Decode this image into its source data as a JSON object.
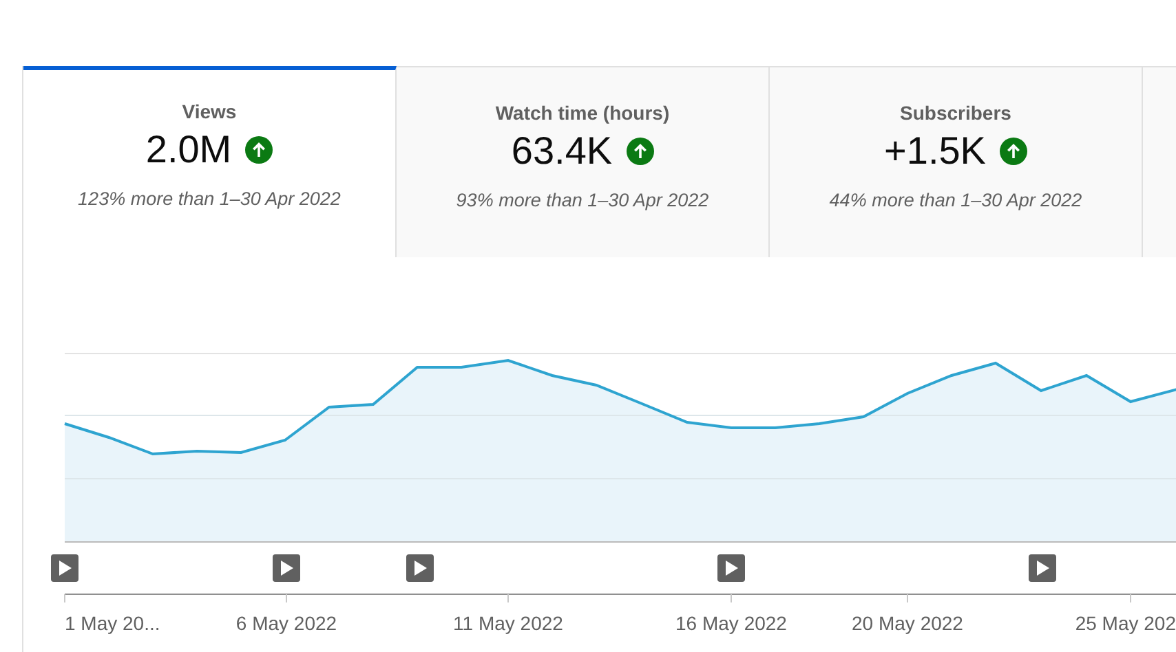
{
  "tabs": [
    {
      "title": "Views",
      "value": "2.0M",
      "up": true,
      "comparison": "123% more than 1–30 Apr 2022",
      "selected": true
    },
    {
      "title": "Watch time (hours)",
      "value": "63.4K",
      "up": true,
      "comparison": "93% more than 1–30 Apr 2022",
      "selected": false
    },
    {
      "title": "Subscribers",
      "value": "+1.5K",
      "up": true,
      "comparison": "44% more than 1–30 Apr 2022",
      "selected": false
    }
  ],
  "chart": {
    "x_labels": [
      "1 May 20...",
      "6 May 2022",
      "11 May 2022",
      "16 May 2022",
      "20 May 2022",
      "25 May 202"
    ]
  }
}
